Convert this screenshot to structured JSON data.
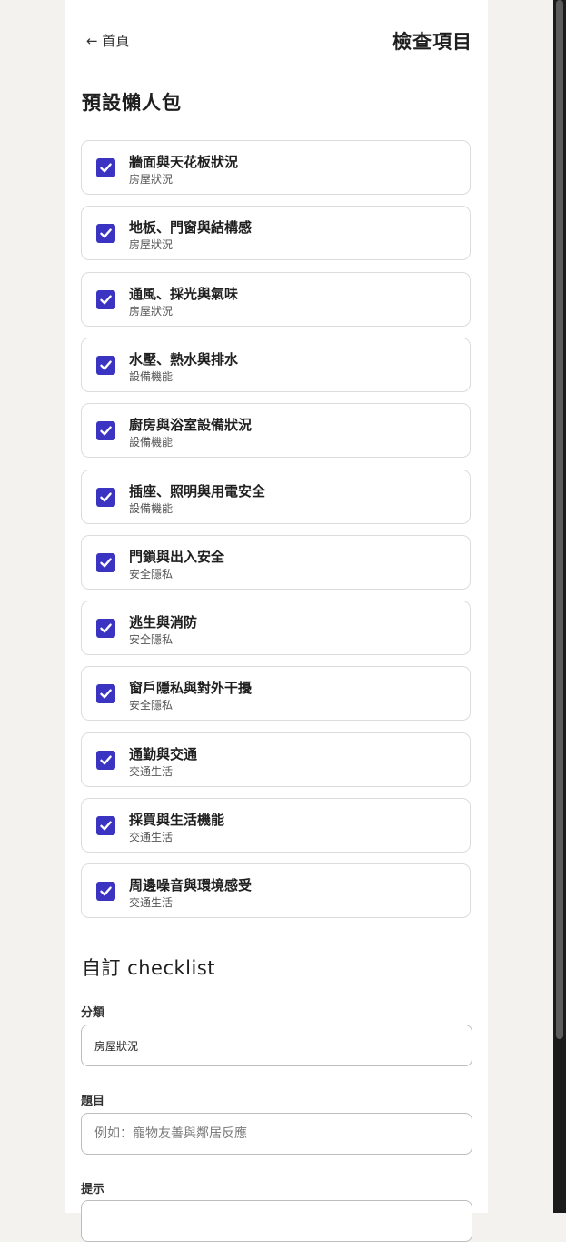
{
  "nav": {
    "back_label": "← 首頁",
    "page_title": "檢查項目"
  },
  "presets": {
    "title": "預設懶人包",
    "items": [
      {
        "title": "牆面與天花板狀況",
        "category": "房屋狀況",
        "checked": true
      },
      {
        "title": "地板、門窗與結構感",
        "category": "房屋狀況",
        "checked": true
      },
      {
        "title": "通風、採光與氣味",
        "category": "房屋狀況",
        "checked": true
      },
      {
        "title": "水壓、熱水與排水",
        "category": "設備機能",
        "checked": true
      },
      {
        "title": "廚房與浴室設備狀況",
        "category": "設備機能",
        "checked": true
      },
      {
        "title": "插座、照明與用電安全",
        "category": "設備機能",
        "checked": true
      },
      {
        "title": "門鎖與出入安全",
        "category": "安全隱私",
        "checked": true
      },
      {
        "title": "逃生與消防",
        "category": "安全隱私",
        "checked": true
      },
      {
        "title": "窗戶隱私與對外干擾",
        "category": "安全隱私",
        "checked": true
      },
      {
        "title": "通勤與交通",
        "category": "交通生活",
        "checked": true
      },
      {
        "title": "採買與生活機能",
        "category": "交通生活",
        "checked": true
      },
      {
        "title": "周邊噪音與環境感受",
        "category": "交通生活",
        "checked": true
      }
    ]
  },
  "custom": {
    "title": "自訂 checklist",
    "category_label": "分類",
    "category_value": "房屋狀況",
    "question_label": "題目",
    "question_placeholder": "例如：寵物友善與鄰居反應",
    "hint_label": "提示"
  },
  "colors": {
    "checkbox": "#3b33c2",
    "background": "#f3f2ef",
    "panel": "#ffffff"
  }
}
